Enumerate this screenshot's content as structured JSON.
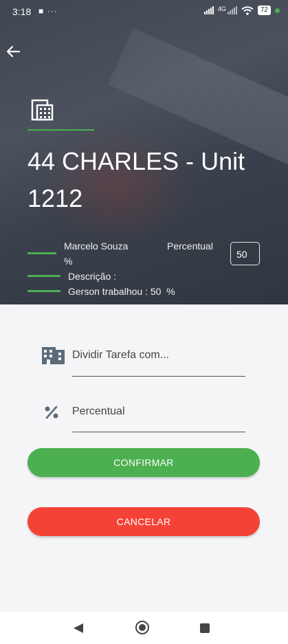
{
  "status_bar": {
    "time": "3:18",
    "left_icons": "■ ···",
    "network_label": "4G",
    "battery": "72"
  },
  "header": {
    "title": "44 CHARLES - Unit 1212",
    "info": {
      "name": "Marcelo Souza",
      "percent_label": "Percentual",
      "percent_symbol": "%",
      "percent_value": "50",
      "description": "Descrição :",
      "worked": "Gerson trabalhou : 50  %"
    }
  },
  "form": {
    "split_task_label": "Dividir Tarefa com...",
    "percent_field_label": "Percentual"
  },
  "buttons": {
    "confirm": "CONFIRMAR",
    "cancel": "CANCELAR"
  },
  "colors": {
    "accent_green": "#4caf50",
    "cancel_red": "#f44336",
    "icon_slate": "#5b6b7a"
  }
}
